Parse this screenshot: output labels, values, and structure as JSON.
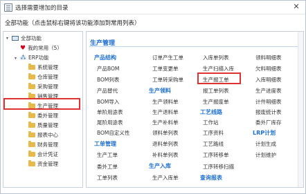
{
  "window": {
    "title": "选择需要增加的目录",
    "close_glyph": "✕"
  },
  "hint": "全部功能（点击鼠标右键将该功能添加到常用列表）",
  "tree": {
    "root": "全部功能",
    "favorites": "我的常用（5）",
    "erp": "ERP功能",
    "modules": [
      "系统管理",
      "仓库管理",
      "采购管理",
      "销售管理",
      "生产管理",
      "委外管理",
      "质量管理",
      "报表中心",
      "财务管理",
      "会计凭证",
      "资金管理"
    ],
    "selected": "生产管理"
  },
  "panel": {
    "section_title": "生产管理",
    "col1": {
      "cat_product": "产品结构",
      "items_product": [
        "产品BOM",
        "BOM列表",
        "产品替代",
        "BOM导入",
        "单阶用途表",
        "尾阶用途表",
        "BOM自定义性"
      ],
      "cat_work": "工单管理",
      "items_work": [
        "生产工单",
        "委外工单",
        "工单列表"
      ]
    },
    "col2": {
      "items_top": [
        "订单产生工单",
        "工单变更单",
        "工单转采购单"
      ],
      "cat_pick": "生产领料",
      "items_pick": [
        "生产领料单",
        "生产退料单",
        "生产补料单",
        "领料单列表",
        "退料单列表",
        "补料单列表"
      ],
      "cat_in": "生产入库",
      "items_in": [
        "生产入库单"
      ]
    },
    "col3": {
      "items_top": [
        "入库单列表",
        "生产扫描入库",
        "生产报工单",
        "报工单列表",
        "生产报废单"
      ],
      "cat_route": "工艺线路",
      "items_route": [
        "工作站",
        "工序资料",
        "工艺路线",
        "工序转移单",
        "工序转移扫描"
      ],
      "cat_query": "查询报表"
    },
    "col4": {
      "items_top": [
        "领料明细表",
        "欠料明细表",
        "入库明细表",
        "生产进度表",
        "计件明细表",
        "报废统计表",
        "委外厂库存"
      ],
      "cat_lrp": "LRP计划",
      "items_lrp": [
        "计划生成",
        "计划维护"
      ]
    }
  }
}
